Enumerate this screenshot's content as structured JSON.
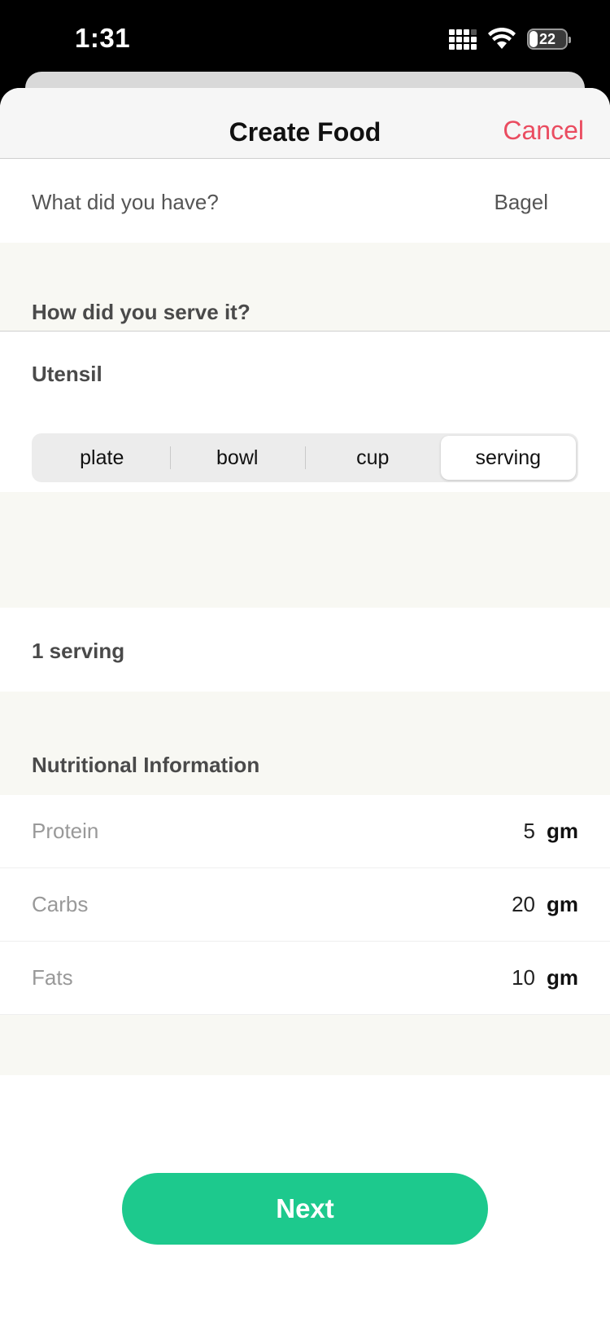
{
  "status_bar": {
    "time": "1:31",
    "battery": "22"
  },
  "nav": {
    "title": "Create Food",
    "cancel_label": "Cancel"
  },
  "food": {
    "question": "What did you have?",
    "value": "Bagel"
  },
  "serve": {
    "heading": "How did you serve it?",
    "utensil_label": "Utensil",
    "options": [
      "plate",
      "bowl",
      "cup",
      "serving"
    ],
    "selected": "serving"
  },
  "quantity": {
    "label": "1 serving"
  },
  "nutrition": {
    "heading": "Nutritional Information",
    "rows": [
      {
        "name": "Protein",
        "value": "5",
        "unit": "gm"
      },
      {
        "name": "Carbs",
        "value": "20",
        "unit": "gm"
      },
      {
        "name": "Fats",
        "value": "10",
        "unit": "gm"
      }
    ]
  },
  "footer": {
    "next_label": "Next"
  },
  "colors": {
    "accent": "#1dc98d",
    "cancel": "#ea4c60"
  }
}
